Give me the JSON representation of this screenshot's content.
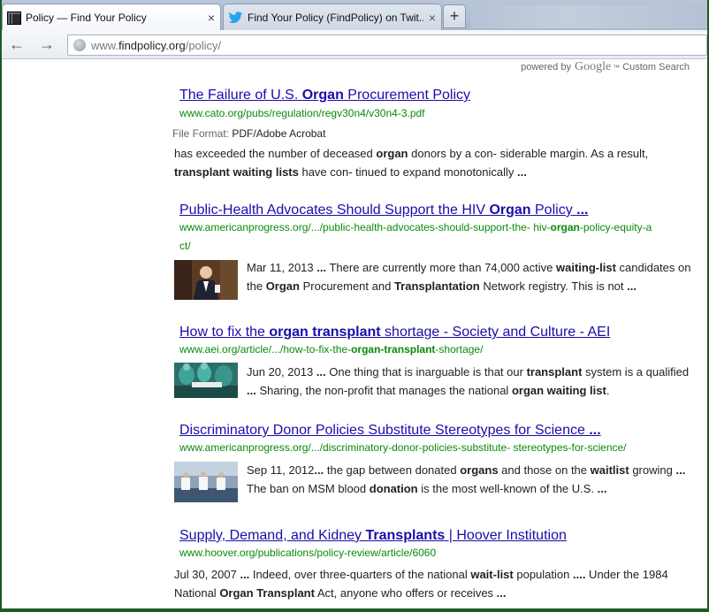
{
  "tabs": [
    {
      "title": "Policy — Find Your Policy",
      "close": "×"
    },
    {
      "title": "Find Your Policy (FindPolicy) on Twit...",
      "close": "×"
    }
  ],
  "newtab_label": "+",
  "nav": {
    "back": "←",
    "forward": "→"
  },
  "url": {
    "prefix": "www.",
    "host": "findpolicy.org",
    "path": "/policy/"
  },
  "powered": {
    "pre": "powered by",
    "brand": "Google",
    "tm": "™",
    "post": "Custom Search"
  },
  "results": [
    {
      "title_parts": [
        "The Failure of U.S. ",
        "Organ",
        " Procurement Policy"
      ],
      "url": "www.cato.org/pubs/regulation/regv30n4/v30n4-3.pdf",
      "file_format_label": "File Format:",
      "file_format_value": "PDF/Adobe Acrobat",
      "line1": [
        "has exceeded the number of deceased ",
        "organ",
        " donors by a con- siderable margin. As a result,"
      ],
      "line2": [
        "transplant waiting lists",
        " have con- tinued to expand monotonically ",
        "..."
      ]
    },
    {
      "title_parts": [
        "Public-Health Advocates Should Support the HIV ",
        "Organ",
        " Policy ",
        "..."
      ],
      "url_line1": [
        "www.americanprogress.org/.../public-health-advocates-should-support-the- hiv-",
        "organ",
        "-policy-equity-a"
      ],
      "url_line2": "ct/",
      "line1": [
        "Mar 11, 2013 ",
        "...",
        " There are currently more than 74,000 active ",
        "waiting-list",
        " candidates on"
      ],
      "line2": [
        "the ",
        "Organ",
        " Procurement and ",
        "Transplantation",
        " Network registry. This is not ",
        "..."
      ],
      "thumb": "person-photo"
    },
    {
      "title_parts": [
        "How to fix the ",
        "organ transplant",
        " shortage - Society and Culture - AEI"
      ],
      "url_parts": [
        "www.aei.org/article/.../how-to-fix-the-",
        "organ-transplant",
        "-shortage/"
      ],
      "line1": [
        "Jun 20, 2013 ",
        "...",
        " One thing that is inarguable is that our ",
        "transplant",
        " system is a qualified"
      ],
      "line2": [
        "...",
        " Sharing, the non-profit that manages the national ",
        "organ waiting list",
        "."
      ],
      "thumb": "surgery-photo"
    },
    {
      "title_parts": [
        "Discriminatory Donor Policies Substitute Stereotypes for Science ",
        "..."
      ],
      "url": "www.americanprogress.org/.../discriminatory-donor-policies-substitute- stereotypes-for-science/",
      "line1": [
        "Sep 11, 2012",
        "...",
        " the gap between donated ",
        "organs",
        " and those on the ",
        "waitlist",
        " growing ",
        "..."
      ],
      "line2": [
        "The ban on MSM blood ",
        "donation",
        " is the most well-known of the U.S. ",
        "..."
      ],
      "thumb": "blood-donation-photo"
    },
    {
      "title_parts": [
        "Supply, Demand, and Kidney ",
        "Transplants",
        " | Hoover Institution"
      ],
      "url": "www.hoover.org/publications/policy-review/article/6060",
      "line1": [
        "Jul 30, 2007 ",
        "...",
        " Indeed, over three-quarters of the national ",
        "wait-list",
        " population ",
        "....",
        " Under the 1984"
      ],
      "line2": [
        "National ",
        "Organ Transplant",
        " Act, anyone who offers or receives ",
        "..."
      ]
    }
  ]
}
